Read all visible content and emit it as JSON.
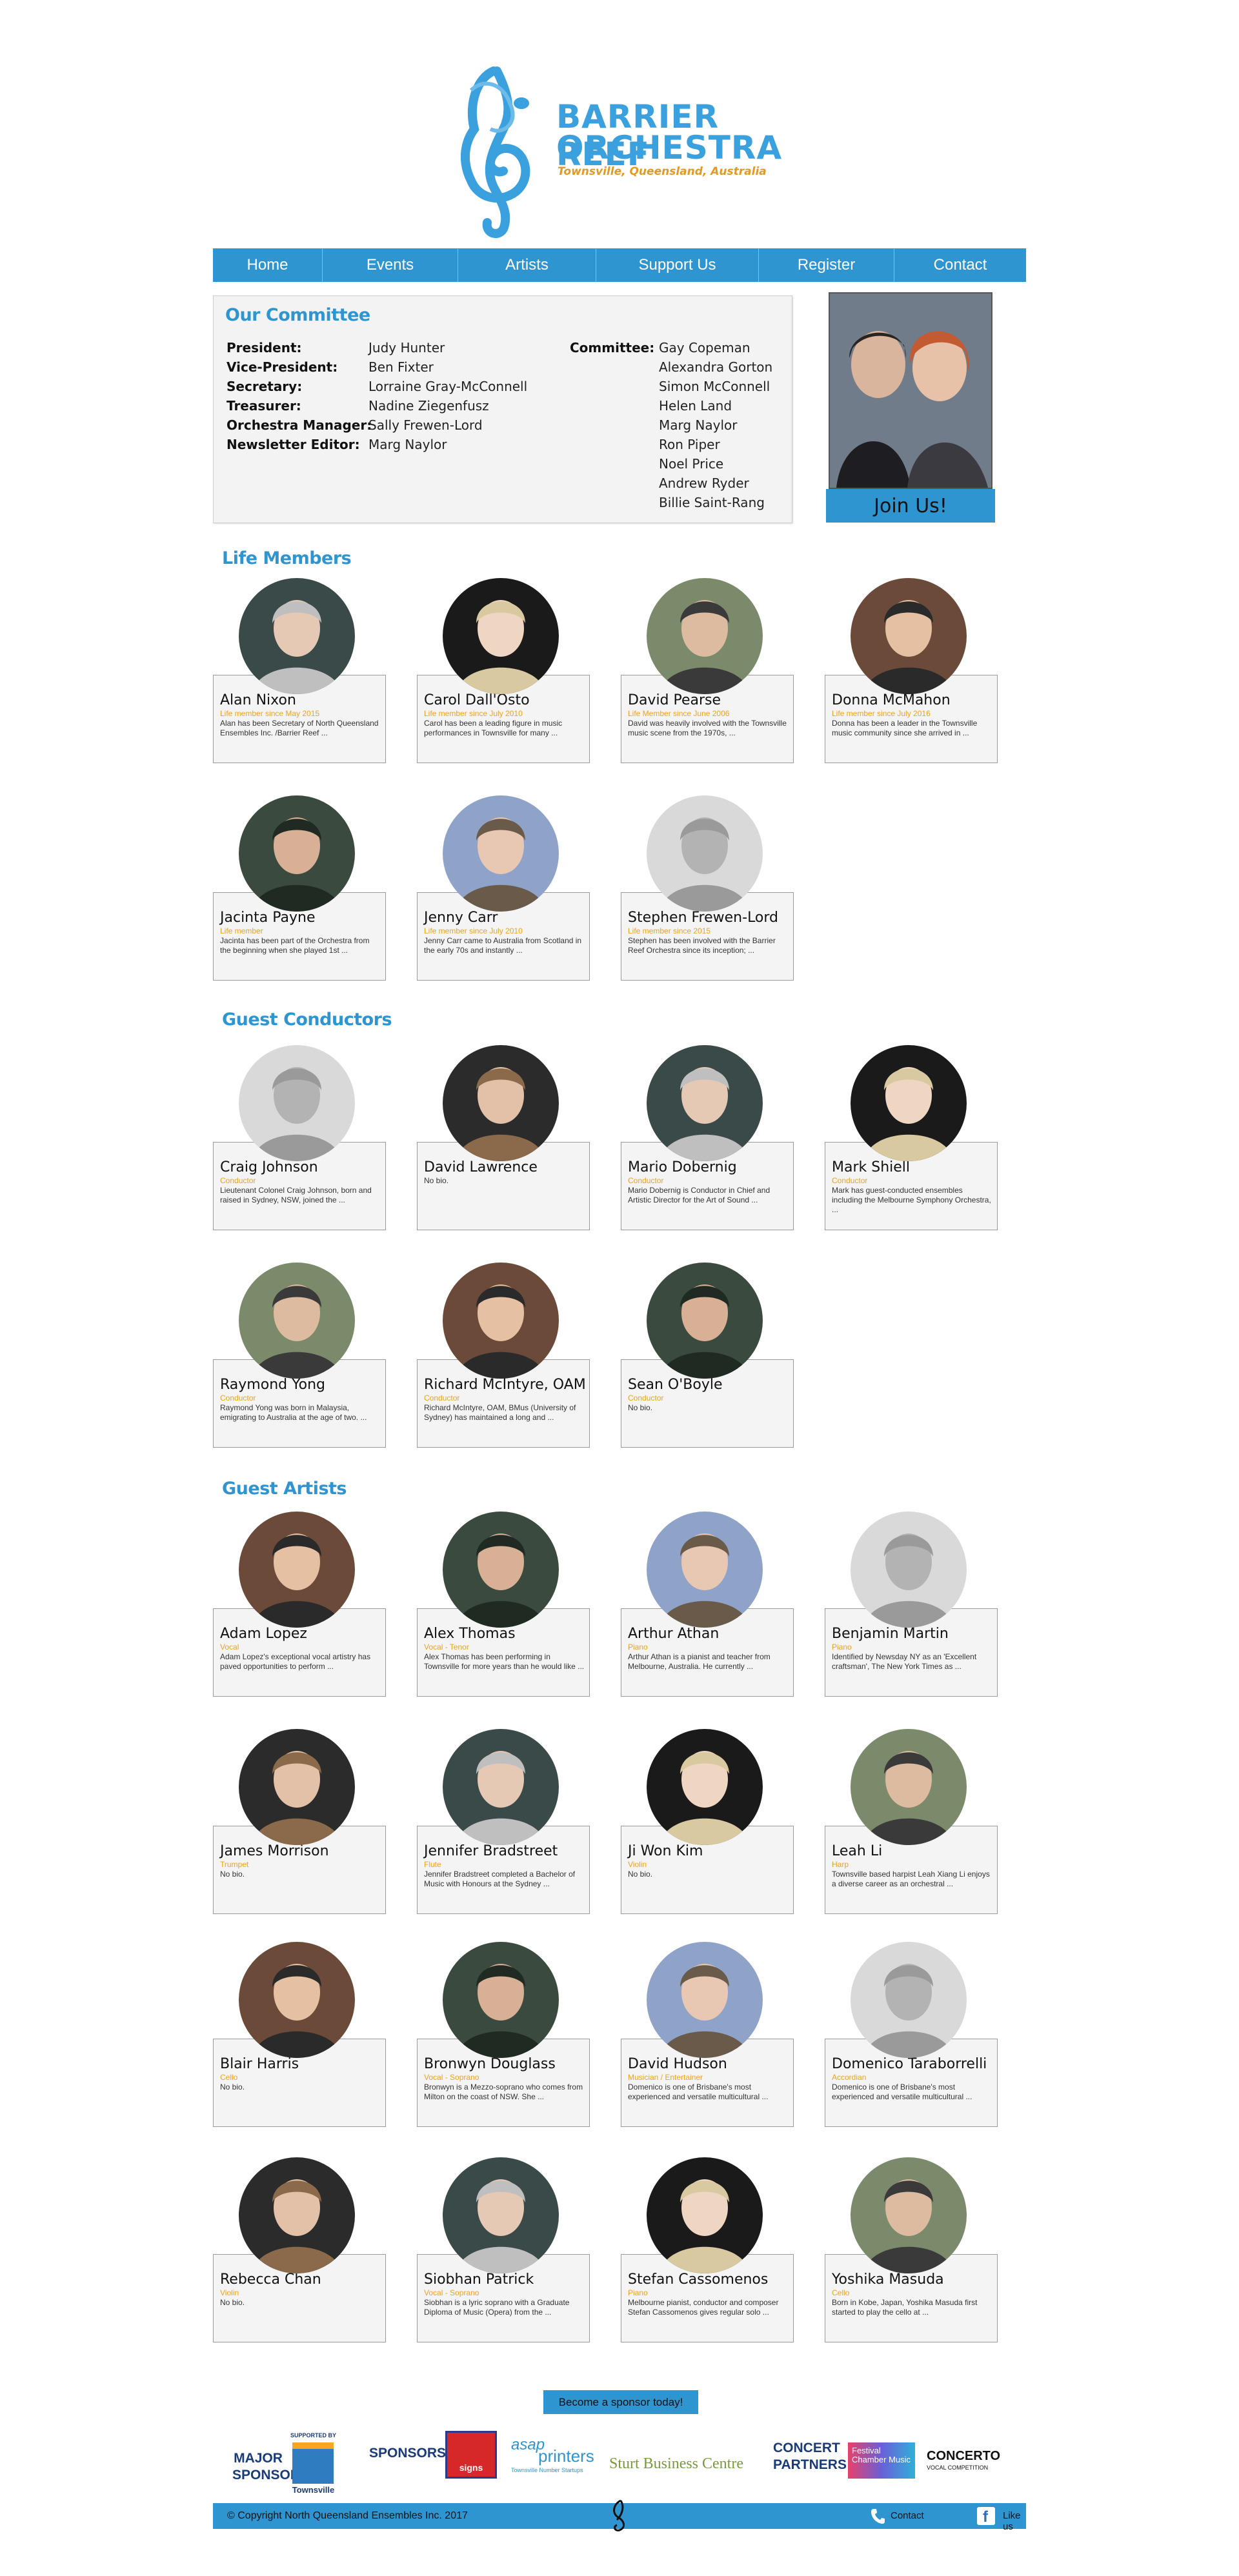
{
  "logo": {
    "line1": "BARRIER REEF",
    "line2": "ORCHESTRA",
    "line3": "Townsville, Queensland, Australia"
  },
  "nav": {
    "items": [
      {
        "label": "Home"
      },
      {
        "label": "Events"
      },
      {
        "label": "Artists"
      },
      {
        "label": "Support Us"
      },
      {
        "label": "Register"
      },
      {
        "label": "Contact"
      }
    ]
  },
  "committee": {
    "title": "Our Committee",
    "officers": [
      {
        "role": "President:",
        "name": "Judy Hunter"
      },
      {
        "role": "Vice-President:",
        "name": "Ben Fixter"
      },
      {
        "role": "Secretary:",
        "name": "Lorraine Gray-McConnell"
      },
      {
        "role": "Treasurer:",
        "name": "Nadine Ziegenfusz"
      },
      {
        "role": "Orchestra Manager:",
        "name": "Sally Frewen-Lord"
      },
      {
        "role": "Newsletter Editor:",
        "name": "Marg Naylor"
      }
    ],
    "committee_label": "Committee:",
    "members": [
      "Gay Copeman",
      "Alexandra Gorton",
      "Simon McConnell",
      "Helen Land",
      "Marg Naylor",
      "Ron Piper",
      "Noel Price",
      "Andrew Ryder",
      "Billie Saint-Rang"
    ]
  },
  "join": {
    "label": "Join Us!"
  },
  "sections": {
    "life_members": "Life Members",
    "guest_conductors": "Guest Conductors",
    "guest_artists": "Guest Artists"
  },
  "life_members": [
    {
      "name": "Alan Nixon",
      "role": "Life member since May 2015",
      "desc": "Alan has been Secretary of North Queensland Ensembles Inc. /Barrier Reef ..."
    },
    {
      "name": "Carol Dall'Osto",
      "role": "Life member since July 2010",
      "desc": "Carol has been a leading figure in music performances in Townsville for many ..."
    },
    {
      "name": "David Pearse",
      "role": "Life Member since June 2006",
      "desc": "David was heavily involved with the Townsville music scene from the 1970s, ..."
    },
    {
      "name": "Donna McMahon",
      "role": "Life member since July 2016",
      "desc": "Donna has been a leader in the Townsville music community since she arrived in ..."
    },
    {
      "name": "Jacinta Payne",
      "role": "Life member",
      "desc": "Jacinta has been part of the Orchestra from the beginning when she played 1st ..."
    },
    {
      "name": "Jenny Carr",
      "role": "Life member since July 2010",
      "desc": "Jenny Carr came to Australia from Scotland in the early 70s and instantly ..."
    },
    {
      "name": "Stephen Frewen-Lord",
      "role": "Life member since 2015",
      "desc": "Stephen has been involved with the Barrier Reef Orchestra since its inception; ..."
    }
  ],
  "conductors": [
    {
      "name": "Craig Johnson",
      "role": "Conductor",
      "desc": "Lieutenant Colonel Craig Johnson, born and raised in Sydney, NSW, joined the ..."
    },
    {
      "name": "David Lawrence",
      "role": "",
      "desc": "No bio."
    },
    {
      "name": "Mario Dobernig",
      "role": "Conductor",
      "desc": "Mario Dobernig is Conductor in Chief and Artistic Director for the Art of Sound ..."
    },
    {
      "name": "Mark Shiell",
      "role": "Conductor",
      "desc": "Mark has guest-conducted ensembles including the Melbourne Symphony Orchestra, ..."
    },
    {
      "name": "Raymond Yong",
      "role": "Conductor",
      "desc": "Raymond Yong was born in Malaysia, emigrating to Australia at the age of two. ..."
    },
    {
      "name": "Richard McIntyre, OAM",
      "role": "Conductor",
      "desc": "Richard McIntyre, OAM, BMus (University of Sydney) has maintained a long and ..."
    },
    {
      "name": "Sean O'Boyle",
      "role": "Conductor",
      "desc": "No bio."
    }
  ],
  "artists": [
    {
      "name": "Adam Lopez",
      "role": "Vocal",
      "desc": "Adam Lopez's exceptional vocal artistry has paved opportunities to perform ..."
    },
    {
      "name": "Alex Thomas",
      "role": "Vocal - Tenor",
      "desc": "Alex Thomas has been performing in Townsville for more years than he would like ..."
    },
    {
      "name": "Arthur Athan",
      "role": "Piano",
      "desc": "Arthur Athan is a pianist and teacher from Melbourne, Australia. He currently ..."
    },
    {
      "name": "Benjamin Martin",
      "role": "Piano",
      "desc": "Identified by Newsday NY as an 'Excellent craftsman', The New York Times as ..."
    },
    {
      "name": "James Morrison",
      "role": "Trumpet",
      "desc": "No bio."
    },
    {
      "name": "Jennifer Bradstreet",
      "role": "Flute",
      "desc": "Jennifer Bradstreet completed a Bachelor of Music with Honours at the Sydney ..."
    },
    {
      "name": "Ji Won Kim",
      "role": "Violin",
      "desc": "No bio."
    },
    {
      "name": "Leah Li",
      "role": "Harp",
      "desc": "Townsville based harpist Leah Xiang Li enjoys a diverse career as an orchestral ..."
    },
    {
      "name": "Blair Harris",
      "role": "Cello",
      "desc": "No bio."
    },
    {
      "name": "Bronwyn Douglass",
      "role": "Vocal - Soprano",
      "desc": "Bronwyn is a Mezzo-soprano who comes from Milton on the coast of NSW. She ..."
    },
    {
      "name": "David Hudson",
      "role": "Musician / Entertainer",
      "desc": "Domenico is one of Brisbane's most experienced and versatile multicultural ..."
    },
    {
      "name": "Domenico Taraborrelli",
      "role": "Accordian",
      "desc": "Domenico is one of Brisbane's most experienced and versatile multicultural ..."
    },
    {
      "name": "Rebecca Chan",
      "role": "Violin",
      "desc": "No bio."
    },
    {
      "name": "Siobhan Patrick",
      "role": "Vocal - Soprano",
      "desc": "Siobhan is a lyric soprano with a Graduate Diploma of Music (Opera) from the ..."
    },
    {
      "name": "Stefan Cassomenos",
      "role": "Piano",
      "desc": "Melbourne pianist, conductor and composer Stefan Cassomenos gives regular solo ..."
    },
    {
      "name": "Yoshika Masuda",
      "role": "Cello",
      "desc": "Born in Kobe, Japan, Yoshika Masuda first started to play the cello at ..."
    }
  ],
  "sponsor": {
    "button": "Become a sponsor today!",
    "major_label": "MAJOR SPONSOR",
    "supported_by": "SUPPORTED BY",
    "townsville": "Townsville",
    "sponsors_label": "SPONSORS",
    "signs": "signs",
    "asap": "asap",
    "printers": "printers",
    "asap_tag": "Townsville Number Startups",
    "sturt": "Sturt Business Centre",
    "concert_partners": "CONCERT PARTNERS",
    "festival": "Festival Chamber Music",
    "concerto": "CONCERTO",
    "concerto_sub": "VOCAL COMPETITION"
  },
  "footer": {
    "copyright": "© Copyright North Queensland Ensembles Inc. 2017",
    "contact": "Contact",
    "like": "Like us"
  }
}
